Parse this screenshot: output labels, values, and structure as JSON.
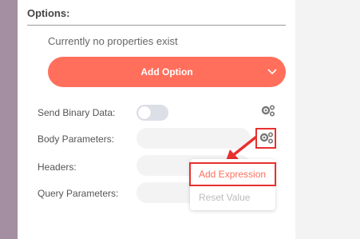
{
  "options_section": {
    "title": "Options:",
    "empty_message": "Currently no properties exist",
    "add_option_label": "Add Option"
  },
  "params": [
    {
      "label": "Send Binary Data:",
      "type": "toggle",
      "enabled": false
    },
    {
      "label": "Body Parameters:",
      "type": "field"
    },
    {
      "label": "Headers:",
      "type": "field"
    },
    {
      "label": "Query Parameters:",
      "type": "field"
    }
  ],
  "context_menu": {
    "items": [
      {
        "label": "Add Expression",
        "highlighted": true
      },
      {
        "label": "Reset Value",
        "disabled": true
      }
    ]
  },
  "colors": {
    "accent": "#ff6f5c",
    "annotation_red": "#e8312e",
    "sidebar": "#a38ea2"
  }
}
